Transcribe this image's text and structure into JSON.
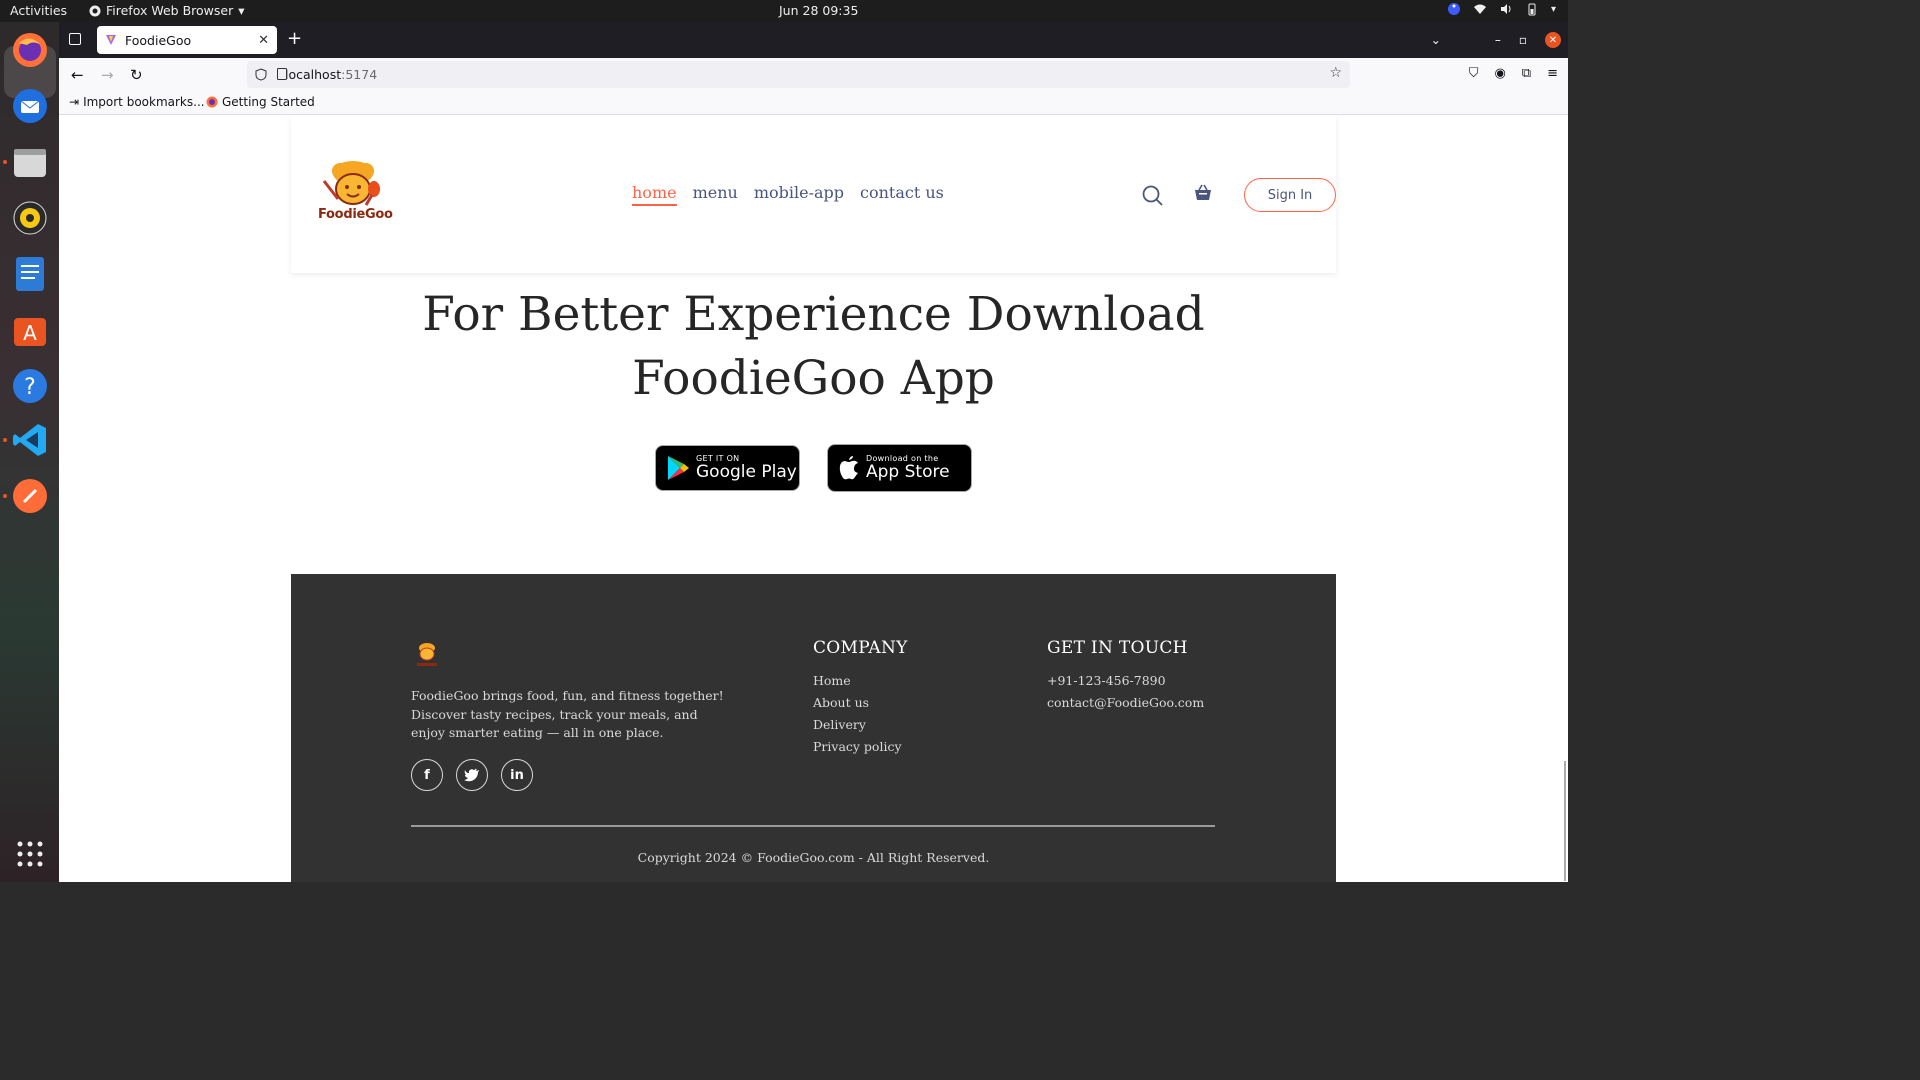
{
  "system": {
    "activities": "Activities",
    "app_menu": "Firefox Web Browser",
    "clock": "Jun 28  09:35"
  },
  "browser": {
    "tab_title": "FoodieGoo",
    "url_host": "localhost",
    "url_port": ":5174",
    "bookmarks": [
      "Import bookmarks...",
      "Getting Started"
    ]
  },
  "header": {
    "logo_text": "FoodieGoo",
    "nav": [
      "home",
      "menu",
      "mobile-app",
      "contact us"
    ],
    "active_nav": "home",
    "sign_in": "Sign In"
  },
  "hero": {
    "title_line1": "For Better Experience Download",
    "title_line2": "FoodieGoo App"
  },
  "stores": {
    "google": {
      "small": "GET IT ON",
      "big": "Google Play"
    },
    "apple": {
      "small": "Download on the",
      "big": "App Store"
    }
  },
  "footer": {
    "description": "FoodieGoo brings food, fun, and fitness together! Discover tasty recipes, track your meals, and enjoy smarter eating — all in one place.",
    "company": {
      "title": "COMPANY",
      "links": [
        "Home",
        "About us",
        "Delivery",
        "Privacy policy"
      ]
    },
    "contact": {
      "title": "GET IN TOUCH",
      "phone": "+91-123-456-7890",
      "email": "contact@FoodieGoo.com"
    },
    "copyright": "Copyright 2024 © FoodieGoo.com - All Right Reserved."
  },
  "colors": {
    "accent": "#ff6347",
    "nav_text": "#49557e",
    "footer_bg": "#323232"
  }
}
